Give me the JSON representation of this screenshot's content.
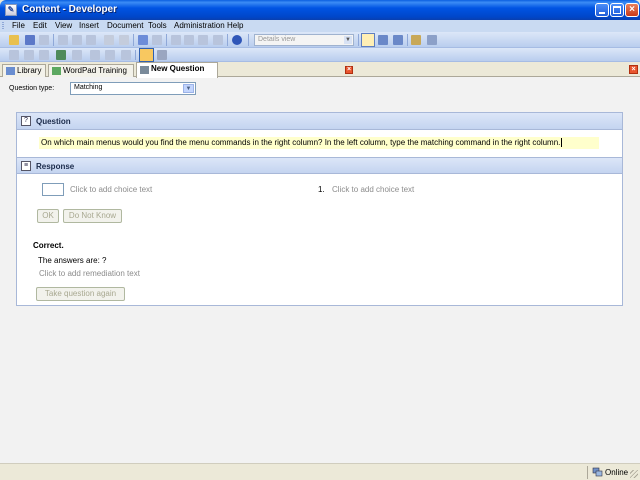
{
  "window": {
    "title": "Content - Developer"
  },
  "menu": [
    "File",
    "Edit",
    "View",
    "Insert",
    "Document",
    "Tools",
    "Administration",
    "Help"
  ],
  "toolbar": {
    "view_select": "Details view"
  },
  "tabs": [
    {
      "label": "Library",
      "active": false
    },
    {
      "label": "WordPad Training",
      "active": false
    },
    {
      "label": "New Question",
      "active": true
    }
  ],
  "question_type": {
    "label": "Question type:",
    "value": "Matching"
  },
  "question": {
    "header": "Question",
    "text": "On which main menus would you find the menu commands in the right column? In the left column, type the matching command in the right column."
  },
  "response": {
    "header": "Response",
    "choice_placeholder": "Click to add choice text",
    "match_number": "1.",
    "match_placeholder": "Click to add choice text",
    "ok_label": "OK",
    "dnk_label": "Do Not Know"
  },
  "feedback": {
    "correct": "Correct.",
    "answers": "The answers are: ?",
    "remediation_placeholder": "Click to add remediation text",
    "retry_label": "Take question again"
  },
  "status": {
    "online": "Online"
  },
  "colors": {
    "titlebar": "#0054E3",
    "question_highlight": "#FFFFCC",
    "section_header": "#C4D4F0"
  }
}
